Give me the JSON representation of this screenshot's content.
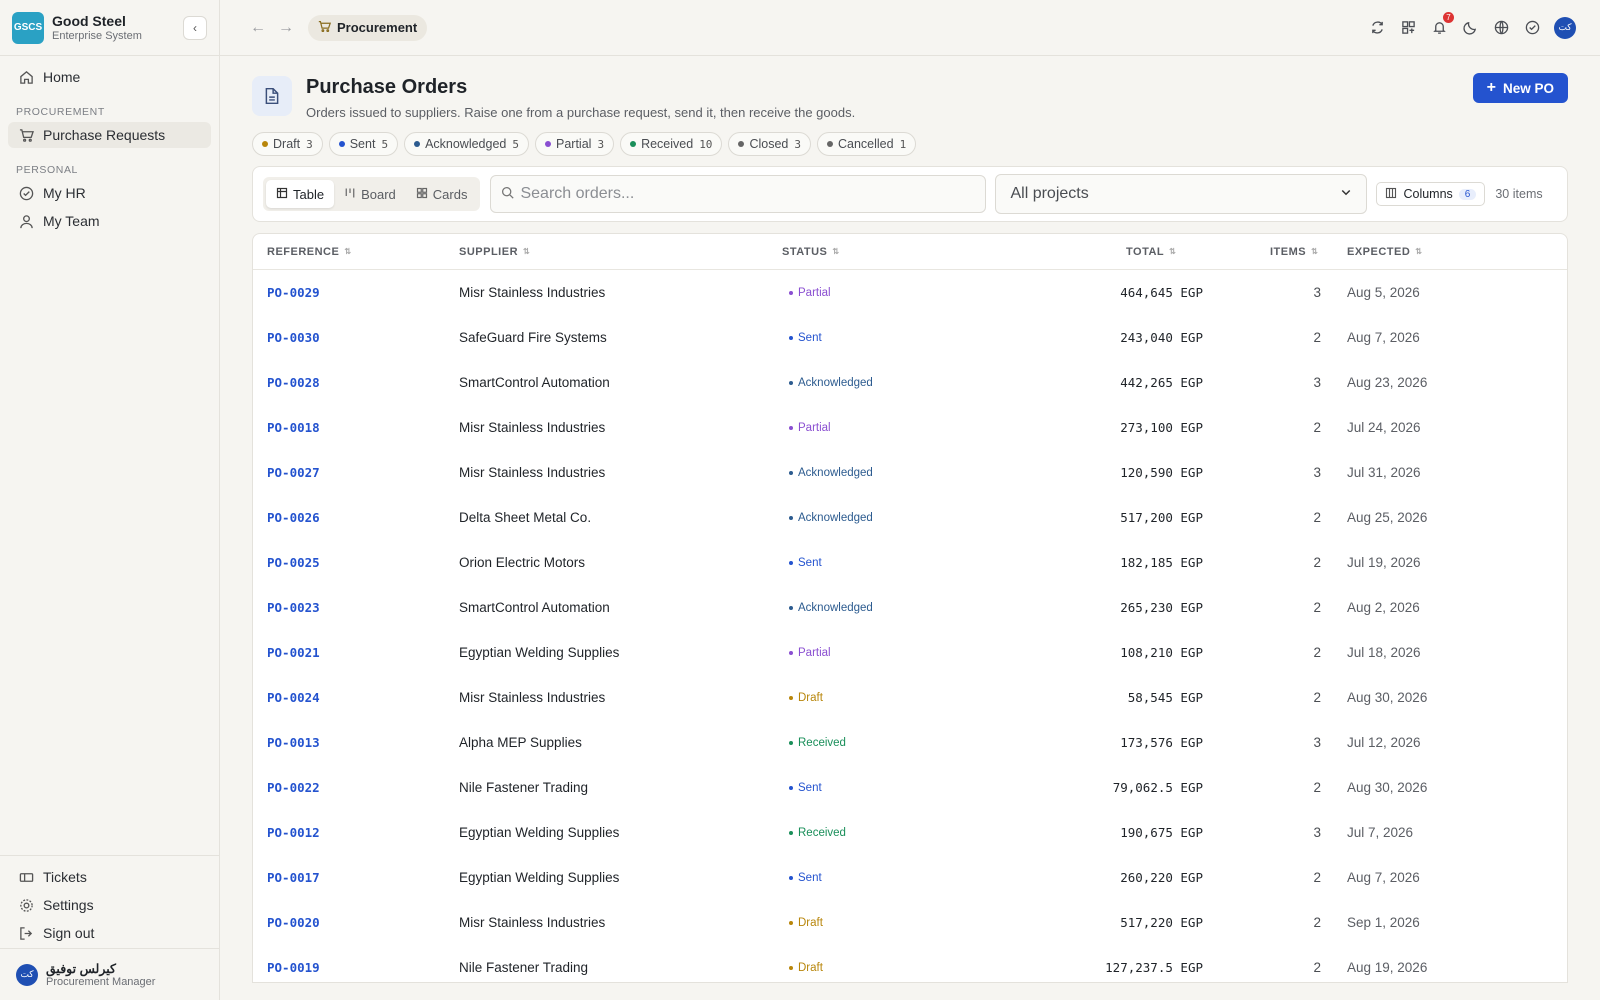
{
  "brand": {
    "logo": "GSCS",
    "name": "Good Steel",
    "subtitle": "Enterprise System"
  },
  "sidebar": {
    "home": "Home",
    "sections": [
      {
        "label": "PROCUREMENT",
        "items": [
          "Purchase Requests"
        ]
      },
      {
        "label": "PERSONAL",
        "items": [
          "My HR",
          "My Team"
        ]
      }
    ],
    "bottom": [
      "Tickets",
      "Settings",
      "Sign out"
    ],
    "user": {
      "initials": "كت",
      "name": "كيرلس توفيق",
      "role": "Procurement Manager"
    }
  },
  "topbar": {
    "breadcrumb": "Procurement",
    "notifications": "7",
    "avatar": "كت"
  },
  "page": {
    "title": "Purchase Orders",
    "subtitle": "Orders issued to suppliers. Raise one from a purchase request, send it, then receive the goods.",
    "new_button": "New PO"
  },
  "status_chips": [
    {
      "label": "Draft",
      "count": "3",
      "color": "#b8860b"
    },
    {
      "label": "Sent",
      "count": "5",
      "color": "#2453cf"
    },
    {
      "label": "Acknowledged",
      "count": "5",
      "color": "#2c5b8f"
    },
    {
      "label": "Partial",
      "count": "3",
      "color": "#8a4fd1"
    },
    {
      "label": "Received",
      "count": "10",
      "color": "#1a8f5a"
    },
    {
      "label": "Closed",
      "count": "3",
      "color": "#666666"
    },
    {
      "label": "Cancelled",
      "count": "1",
      "color": "#666666"
    }
  ],
  "toolbar": {
    "views": [
      "Table",
      "Board",
      "Cards"
    ],
    "search_placeholder": "Search orders...",
    "project_select": "All projects",
    "columns_label": "Columns",
    "columns_count": "6",
    "items_count": "30 items"
  },
  "table": {
    "headers": [
      "REFERENCE",
      "SUPPLIER",
      "STATUS",
      "TOTAL",
      "ITEMS",
      "EXPECTED"
    ],
    "rows": [
      {
        "ref": "PO-0029",
        "supplier": "Misr Stainless Industries",
        "status": "Partial",
        "total": "464,645 EGP",
        "items": "3",
        "expected": "Aug 5, 2026"
      },
      {
        "ref": "PO-0030",
        "supplier": "SafeGuard Fire Systems",
        "status": "Sent",
        "total": "243,040 EGP",
        "items": "2",
        "expected": "Aug 7, 2026"
      },
      {
        "ref": "PO-0028",
        "supplier": "SmartControl Automation",
        "status": "Acknowledged",
        "total": "442,265 EGP",
        "items": "3",
        "expected": "Aug 23, 2026"
      },
      {
        "ref": "PO-0018",
        "supplier": "Misr Stainless Industries",
        "status": "Partial",
        "total": "273,100 EGP",
        "items": "2",
        "expected": "Jul 24, 2026"
      },
      {
        "ref": "PO-0027",
        "supplier": "Misr Stainless Industries",
        "status": "Acknowledged",
        "total": "120,590 EGP",
        "items": "3",
        "expected": "Jul 31, 2026"
      },
      {
        "ref": "PO-0026",
        "supplier": "Delta Sheet Metal Co.",
        "status": "Acknowledged",
        "total": "517,200 EGP",
        "items": "2",
        "expected": "Aug 25, 2026"
      },
      {
        "ref": "PO-0025",
        "supplier": "Orion Electric Motors",
        "status": "Sent",
        "total": "182,185 EGP",
        "items": "2",
        "expected": "Jul 19, 2026"
      },
      {
        "ref": "PO-0023",
        "supplier": "SmartControl Automation",
        "status": "Acknowledged",
        "total": "265,230 EGP",
        "items": "2",
        "expected": "Aug 2, 2026"
      },
      {
        "ref": "PO-0021",
        "supplier": "Egyptian Welding Supplies",
        "status": "Partial",
        "total": "108,210 EGP",
        "items": "2",
        "expected": "Jul 18, 2026"
      },
      {
        "ref": "PO-0024",
        "supplier": "Misr Stainless Industries",
        "status": "Draft",
        "total": "58,545 EGP",
        "items": "2",
        "expected": "Aug 30, 2026"
      },
      {
        "ref": "PO-0013",
        "supplier": "Alpha MEP Supplies",
        "status": "Received",
        "total": "173,576 EGP",
        "items": "3",
        "expected": "Jul 12, 2026"
      },
      {
        "ref": "PO-0022",
        "supplier": "Nile Fastener Trading",
        "status": "Sent",
        "total": "79,062.5 EGP",
        "items": "2",
        "expected": "Aug 30, 2026"
      },
      {
        "ref": "PO-0012",
        "supplier": "Egyptian Welding Supplies",
        "status": "Received",
        "total": "190,675 EGP",
        "items": "3",
        "expected": "Jul 7, 2026"
      },
      {
        "ref": "PO-0017",
        "supplier": "Egyptian Welding Supplies",
        "status": "Sent",
        "total": "260,220 EGP",
        "items": "2",
        "expected": "Aug 7, 2026"
      },
      {
        "ref": "PO-0020",
        "supplier": "Misr Stainless Industries",
        "status": "Draft",
        "total": "517,220 EGP",
        "items": "2",
        "expected": "Sep 1, 2026"
      },
      {
        "ref": "PO-0019",
        "supplier": "Nile Fastener Trading",
        "status": "Draft",
        "total": "127,237.5 EGP",
        "items": "2",
        "expected": "Aug 19, 2026"
      }
    ]
  },
  "status_colors": {
    "Draft": "#b8860b",
    "Sent": "#2453cf",
    "Acknowledged": "#2c5b8f",
    "Partial": "#8a4fd1",
    "Received": "#1a8f5a"
  }
}
